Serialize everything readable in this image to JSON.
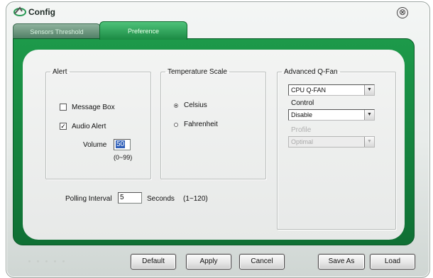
{
  "window": {
    "title": "Config",
    "close_glyph": "⊗"
  },
  "tabs": [
    {
      "label": "Sensors Threshold",
      "active": false
    },
    {
      "label": "Preference",
      "active": true
    }
  ],
  "alert": {
    "legend": "Alert",
    "message_box": {
      "label": "Message Box",
      "checked": false
    },
    "audio_alert": {
      "label": "Audio Alert",
      "checked": true,
      "mark": "✓"
    },
    "volume": {
      "label": "Volume",
      "value": "50",
      "range": "(0~99)"
    }
  },
  "temperature_scale": {
    "legend": "Temperature Scale",
    "options": [
      {
        "label": "Celsius",
        "selected": true
      },
      {
        "label": "Fahrenheit",
        "selected": false
      }
    ]
  },
  "polling": {
    "label": "Polling Interval",
    "value": "5",
    "unit_label": "Seconds",
    "range": "(1~120)"
  },
  "advanced_qfan": {
    "legend": "Advanced Q-Fan",
    "fan_select": {
      "value": "CPU Q-FAN"
    },
    "control": {
      "label": "Control",
      "value": "Disable"
    },
    "profile": {
      "label": "Profile",
      "value": "Optimal",
      "disabled": true
    },
    "arrow_glyph": "▼"
  },
  "buttons": {
    "default": "Default",
    "apply": "Apply",
    "cancel": "Cancel",
    "save_as": "Save As",
    "load": "Load"
  },
  "colors": {
    "tab_active": "#1b8a43",
    "frame": "#0f6f34",
    "panel": "#eceeed"
  }
}
